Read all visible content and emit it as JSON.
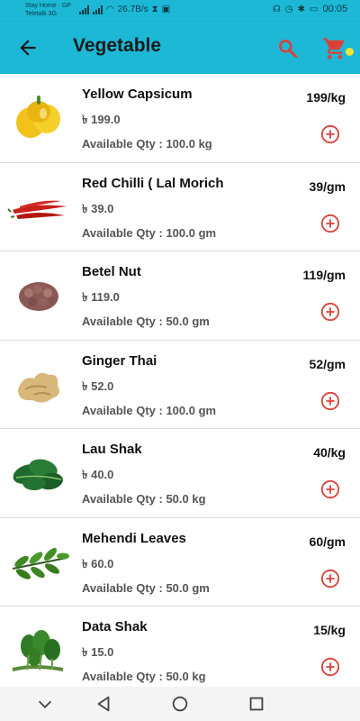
{
  "status": {
    "carrier_line1": "Stay Home · GP",
    "carrier_line2": "Teletalk 3G",
    "speed": "26.7B/s",
    "time": "00:05"
  },
  "header": {
    "title": "Vegetable",
    "back_icon": "arrow-back-icon",
    "search_icon": "search-icon",
    "cart_icon": "cart-icon"
  },
  "colors": {
    "app_bar": "#1cb8d6",
    "accent_red": "#d9423a",
    "cart_badge": "#f3e23a"
  },
  "products": [
    {
      "name": "Yellow Capsicum",
      "price": "৳ 199.0",
      "qty": "Available Qty : 100.0 kg",
      "unit_price": "199/kg"
    },
    {
      "name": "Red Chilli ( Lal Morich",
      "price": "৳ 39.0",
      "qty": "Available Qty : 100.0 gm",
      "unit_price": "39/gm"
    },
    {
      "name": "Betel Nut",
      "price": "৳ 119.0",
      "qty": "Available Qty : 50.0 gm",
      "unit_price": "119/gm"
    },
    {
      "name": "Ginger Thai",
      "price": "৳ 52.0",
      "qty": "Available Qty : 100.0 gm",
      "unit_price": "52/gm"
    },
    {
      "name": "Lau Shak",
      "price": "৳ 40.0",
      "qty": "Available Qty : 50.0 kg",
      "unit_price": "40/kg"
    },
    {
      "name": "Mehendi Leaves",
      "price": "৳ 60.0",
      "qty": "Available Qty : 50.0 gm",
      "unit_price": "60/gm"
    },
    {
      "name": "Data Shak",
      "price": "৳ 15.0",
      "qty": "Available Qty : 50.0 kg",
      "unit_price": "15/kg"
    }
  ],
  "nav": {
    "icons": [
      "chevron-down-icon",
      "back-triangle-icon",
      "home-circle-icon",
      "recents-square-icon"
    ]
  }
}
